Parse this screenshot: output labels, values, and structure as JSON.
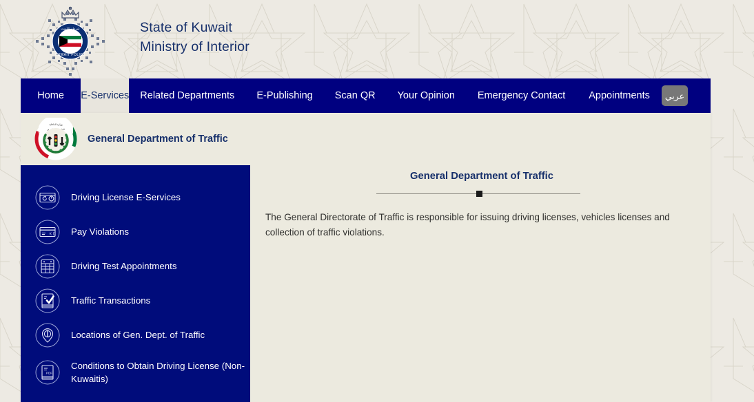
{
  "header": {
    "emblem_name": "kuwait-police-emblem",
    "title_line1": "State of Kuwait",
    "title_line2": "Ministry of Interior"
  },
  "nav": {
    "items": [
      {
        "label": "Home",
        "active": false
      },
      {
        "label": "E-Services",
        "active": true
      },
      {
        "label": "Related Departments",
        "active": false
      },
      {
        "label": "E-Publishing",
        "active": false
      },
      {
        "label": "Scan QR",
        "active": false
      },
      {
        "label": "Your Opinion",
        "active": false
      },
      {
        "label": "Emergency Contact",
        "active": false
      },
      {
        "label": "Appointments",
        "active": false
      }
    ],
    "lang_button": "عربي"
  },
  "department": {
    "emblem_name": "general-department-of-traffic-emblem",
    "name": "General Department of Traffic"
  },
  "sidebar": {
    "items": [
      {
        "label": "Driving License E-Services",
        "icon": "license-card-icon"
      },
      {
        "label": "Pay Violations",
        "icon": "payment-card-kd-icon"
      },
      {
        "label": "Driving Test Appointments",
        "icon": "calendar-icon"
      },
      {
        "label": "Traffic Transactions",
        "icon": "document-check-icon"
      },
      {
        "label": "Locations of Gen. Dept. of Traffic",
        "icon": "location-pin-icon"
      },
      {
        "label": "Conditions to Obtain Driving License (Non-Kuwaitis)",
        "icon": "pdf-document-icon"
      }
    ]
  },
  "main": {
    "title": "General Department of Traffic",
    "body": "The General Directorate of Traffic is responsible for issuing driving licenses, vehicles licenses and collection of traffic violations."
  },
  "colors": {
    "navy": "#000080",
    "sidebar_navy": "#000c7b",
    "page_bg": "#edeae3",
    "panel_bg": "#eceadf",
    "title_blue": "#17306b",
    "lang_button_bg": "#787878"
  }
}
